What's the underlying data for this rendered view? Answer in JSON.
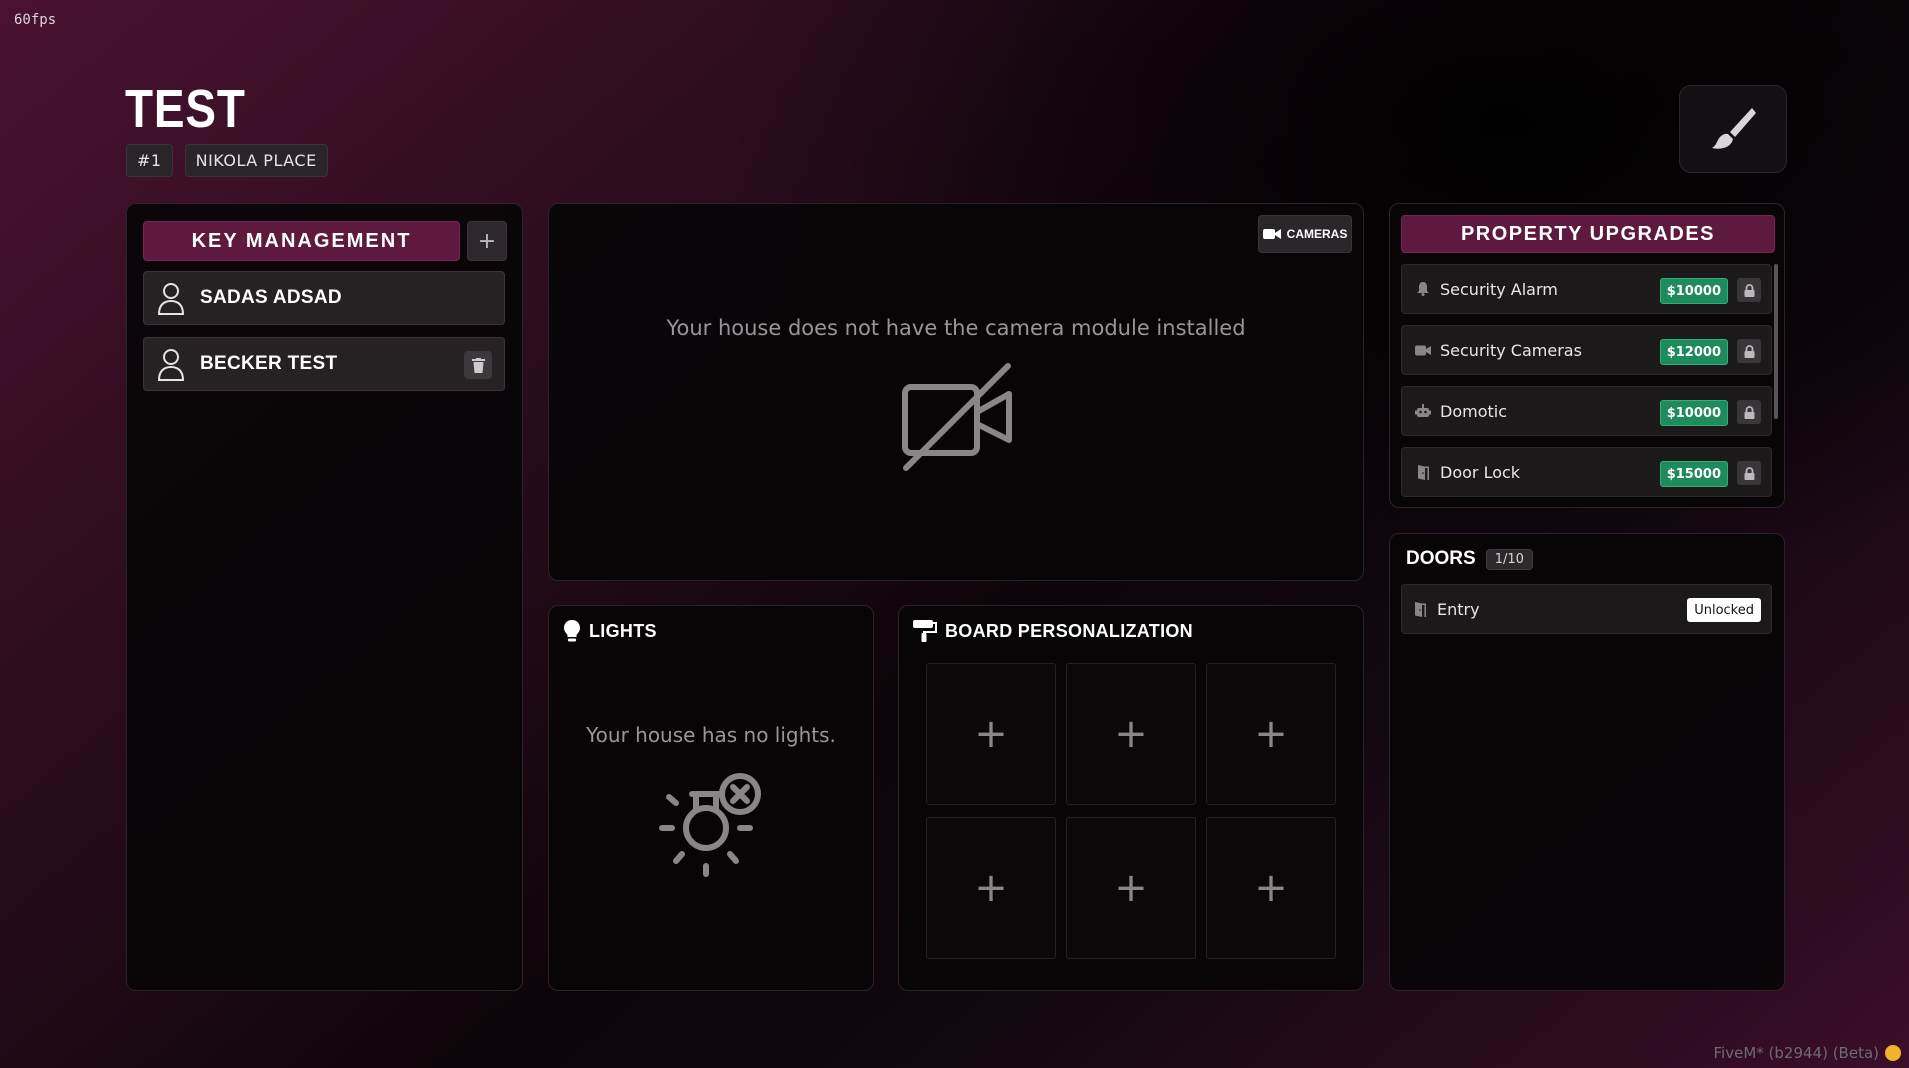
{
  "overlay": {
    "fps": "60fps",
    "footer": "FiveM* (b2944) (Beta)"
  },
  "header": {
    "title": "TEST",
    "chips": [
      "#1",
      "NIKOLA PLACE"
    ]
  },
  "key_management": {
    "title": "KEY MANAGEMENT",
    "add_label": "+",
    "users": [
      {
        "name": "SADAS ADSAD",
        "deletable": false
      },
      {
        "name": "BECKER TEST",
        "deletable": true
      }
    ]
  },
  "cameras": {
    "button_label": "CAMERAS",
    "message": "Your house does not have the camera module installed"
  },
  "lights": {
    "title": "LIGHTS",
    "message": "Your house has no lights."
  },
  "board": {
    "title": "BOARD PERSONALIZATION",
    "slot_label": "+"
  },
  "upgrades": {
    "title": "PROPERTY UPGRADES",
    "items": [
      {
        "label": "Security Alarm",
        "price": "$10000",
        "icon": "bell-icon"
      },
      {
        "label": "Security Cameras",
        "price": "$12000",
        "icon": "video-camera-icon"
      },
      {
        "label": "Domotic",
        "price": "$10000",
        "icon": "robot-icon"
      },
      {
        "label": "Door Lock",
        "price": "$15000",
        "icon": "door-icon"
      }
    ]
  },
  "doors": {
    "title": "DOORS",
    "count": "1/10",
    "items": [
      {
        "label": "Entry",
        "status": "Unlocked"
      }
    ]
  },
  "colors": {
    "accent": "#5e1a3e",
    "price_green": "#1f8a5c"
  }
}
